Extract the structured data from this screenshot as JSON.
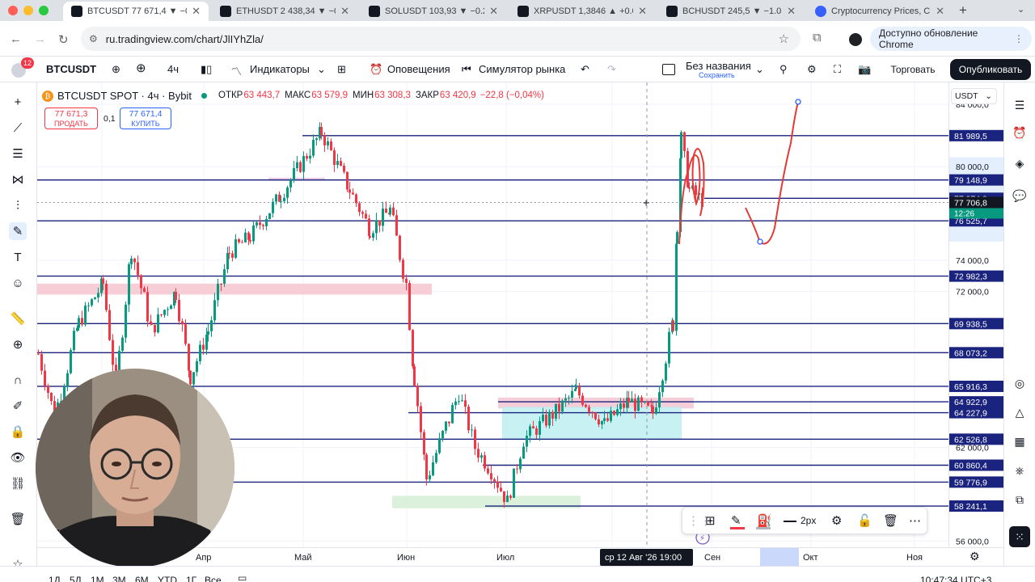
{
  "browser": {
    "tabs": [
      {
        "title": "BTCUSDT 77 671,4 ▼ −0.2",
        "active": true
      },
      {
        "title": "ETHUSDT 2 438,34 ▼ −0.",
        "active": false
      },
      {
        "title": "SOLUSDT 103,93 ▼ −0.2",
        "active": false
      },
      {
        "title": "XRPUSDT 1,3846 ▲ +0.0",
        "active": false
      },
      {
        "title": "BCHUSDT 245,5 ▼ −1.05",
        "active": false
      },
      {
        "title": "Cryptocurrency Prices, C",
        "active": false
      }
    ],
    "url": "ru.tradingview.com/chart/JlIYhZla/",
    "update_label": "Доступно обновление Chrome"
  },
  "header": {
    "notif_count": "12",
    "symbol": "BTCUSDT",
    "interval": "4ч",
    "indicators": "Индикаторы",
    "alerts": "Оповещения",
    "simulator": "Симулятор рынка",
    "layout_name": "Без названия",
    "saved": "Сохранить",
    "trade": "Торговать",
    "publish": "Опубликовать"
  },
  "legend": {
    "title": "BTCUSDT SPOT · 4ч · Bybit",
    "o_label": "ОТКР",
    "o": "63 443,7",
    "h_label": "МАКС",
    "h": "63 579,9",
    "l_label": "МИН",
    "l": "63 308,3",
    "c_label": "ЗАКР",
    "c": "63 420,9",
    "change": "−22,8 (−0,04%)",
    "sell_price": "77 671,3",
    "sell_label": "ПРОДАТЬ",
    "spread": "0,1",
    "buy_price": "77 671,4",
    "buy_label": "КУПИТЬ"
  },
  "price_scale": {
    "currency": "USDT"
  },
  "time_scale": {
    "crosshair_label": "ср 12 Авг '26   19:00"
  },
  "draw_toolbar": {
    "width_label": "2px"
  },
  "bottom": {
    "ranges": [
      "1Д",
      "5Д",
      "1М",
      "3М",
      "6М",
      "YTD",
      "1Г",
      "Все"
    ],
    "clock": "10:47:34 UTC+3"
  },
  "colors": {
    "up": "#089981",
    "down": "#f23645",
    "line": "#1a237e",
    "accent": "#2962ff",
    "sell": "#f23645",
    "buy": "#2962ff"
  },
  "chart_data": {
    "type": "candlestick",
    "symbol": "BTCUSDT SPOT",
    "exchange": "Bybit",
    "interval": "4ч",
    "ylim": [
      55600,
      85400
    ],
    "x_ticks": [
      "Апр",
      "Май",
      "Июн",
      "Июл",
      "Авг",
      "Сен",
      "Окт",
      "Ноя"
    ],
    "y_ticks": [
      56000,
      62000,
      72000,
      74000,
      80000,
      84000
    ],
    "y_tick_labels": [
      "56 000,0",
      "62 000,0",
      "72 000,0",
      "74 000,0",
      "80 000,0",
      "84 000,0"
    ],
    "horizontal_lines": [
      {
        "value": 81989.5,
        "label": "81 989,5"
      },
      {
        "value": 79148.9,
        "label": "79 148,9"
      },
      {
        "value": 77974.8,
        "label": "77 974,8"
      },
      {
        "value": 76525.7,
        "label": "76 525,7"
      },
      {
        "value": 72982.3,
        "label": "72 982,3"
      },
      {
        "value": 69938.5,
        "label": "69 938,5"
      },
      {
        "value": 68073.2,
        "label": "68 073,2"
      },
      {
        "value": 65916.3,
        "label": "65 916,3"
      },
      {
        "value": 64922.9,
        "label": "64 922,9"
      },
      {
        "value": 64227.9,
        "label": "64 227,9"
      },
      {
        "value": 62526.8,
        "label": "62 526,8"
      },
      {
        "value": 60860.4,
        "label": "60 860,4"
      },
      {
        "value": 59776.9,
        "label": "59 776,9"
      },
      {
        "value": 58241.1,
        "label": "58 241,1"
      }
    ],
    "last_price": {
      "value": 77706.8,
      "label": "77 706,8",
      "countdown": "12:26"
    },
    "zones": [
      {
        "color": "#f7c5cf",
        "from": 71800,
        "to": 72500
      },
      {
        "color": "#eec8e8",
        "from": 79100,
        "to": 79300
      },
      {
        "color": "#f5c6d3",
        "from": 64500,
        "to": 65200
      },
      {
        "color": "#bdeef0",
        "from": 62500,
        "to": 64600
      },
      {
        "color": "#d6efd6",
        "from": 58100,
        "to": 58900
      }
    ],
    "price_path": [
      {
        "x": "Мар",
        "y": 68000
      },
      {
        "x": "Мар",
        "y": 64000
      },
      {
        "x": "Мар",
        "y": 70000
      },
      {
        "x": "Мар",
        "y": 72500
      },
      {
        "x": "Апр",
        "y": 66000
      },
      {
        "x": "Апр",
        "y": 74800
      },
      {
        "x": "Апр",
        "y": 69500
      },
      {
        "x": "Апр",
        "y": 72000
      },
      {
        "x": "Апр",
        "y": 66500
      },
      {
        "x": "Апр",
        "y": 69500
      },
      {
        "x": "Апр",
        "y": 74500
      },
      {
        "x": "Апр",
        "y": 75500
      },
      {
        "x": "Май",
        "y": 78200
      },
      {
        "x": "Май",
        "y": 82200
      },
      {
        "x": "Май",
        "y": 78500
      },
      {
        "x": "Май",
        "y": 76000
      },
      {
        "x": "Июн",
        "y": 77200
      },
      {
        "x": "Июн",
        "y": 72500
      },
      {
        "x": "Июн",
        "y": 66500
      },
      {
        "x": "Июн",
        "y": 60000
      },
      {
        "x": "Июн",
        "y": 65500
      },
      {
        "x": "Июн",
        "y": 62000
      },
      {
        "x": "Июн",
        "y": 60500
      },
      {
        "x": "Июл",
        "y": 58500
      },
      {
        "x": "Июл",
        "y": 62500
      },
      {
        "x": "Июл",
        "y": 64300
      },
      {
        "x": "Июл",
        "y": 65600
      },
      {
        "x": "Авг",
        "y": 63500
      },
      {
        "x": "Авг",
        "y": 65000
      },
      {
        "x": "Авг",
        "y": 64200
      },
      {
        "x": "Авг",
        "y": 70000
      },
      {
        "x": "Авг",
        "y": 76500
      },
      {
        "x": "Авг",
        "y": 81800
      },
      {
        "x": "Авг",
        "y": 78500
      },
      {
        "x": "Авг",
        "y": 77700
      }
    ]
  }
}
